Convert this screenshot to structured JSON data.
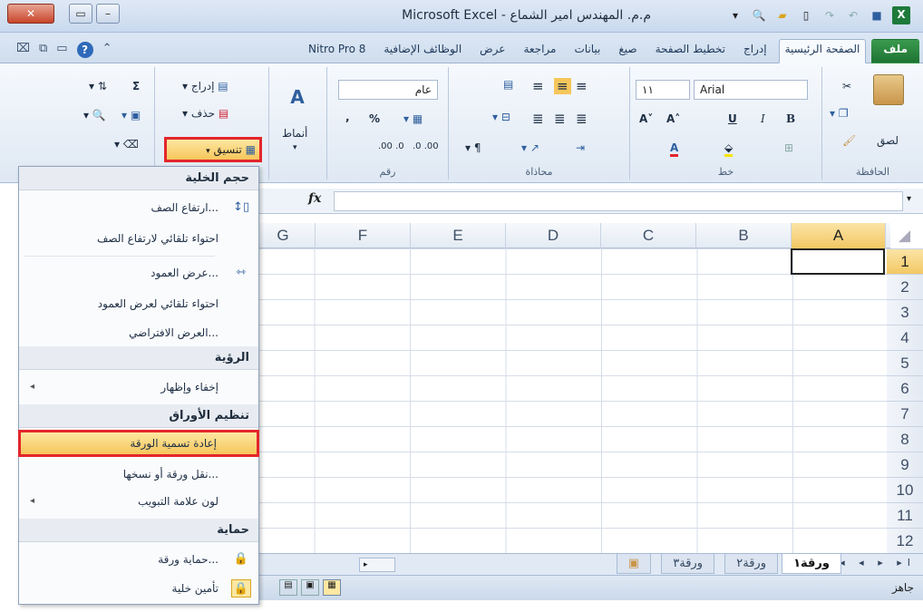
{
  "window": {
    "title": "م.م. المهندس امير الشماع - Microsoft Excel"
  },
  "tabs": {
    "file": "ملف",
    "home": "الصفحة الرئيسية",
    "insert": "إدراج",
    "page_layout": "تخطيط الصفحة",
    "formulas": "صيغ",
    "data": "بيانات",
    "review": "مراجعة",
    "view": "عرض",
    "addins": "الوظائف الإضافية",
    "nitro": "Nitro Pro 8"
  },
  "ribbon": {
    "clipboard": {
      "label": "الحافظة",
      "paste": "لصق"
    },
    "font": {
      "label": "خط",
      "name": "Arial",
      "size": "١١",
      "bold": "B",
      "italic": "I",
      "underline": "U"
    },
    "alignment": {
      "label": "محاذاة"
    },
    "number": {
      "label": "رقم",
      "format": "عام",
      "percent": "%",
      "comma": ","
    },
    "styles": {
      "label": "أنماط"
    },
    "cells": {
      "insert": "إدراج",
      "delete": "حذف",
      "format": "تنسيق"
    },
    "editing": {
      "sum": "Σ"
    }
  },
  "formula_bar": {
    "fx": "fx"
  },
  "grid": {
    "columns": [
      "A",
      "B",
      "C",
      "D",
      "E",
      "F",
      "G"
    ],
    "rows": [
      "1",
      "2",
      "3",
      "4",
      "5",
      "6",
      "7",
      "8",
      "9",
      "10",
      "11",
      "12"
    ],
    "selected_cell": "A1"
  },
  "menu": {
    "sections": {
      "cell_size": "حجم الخلية",
      "visibility": "الرؤية",
      "organize_sheets": "تنظيم الأوراق",
      "protection": "حماية"
    },
    "items": {
      "row_height": "ارتفاع الصف...",
      "autofit_row": "احتواء تلقائي لارتفاع الصف",
      "column_width": "عرض العمود...",
      "autofit_column": "احتواء تلقائي لعرض العمود",
      "default_width": "العرض الافتراضي...",
      "hide_unhide": "إخفاء وإظهار",
      "rename_sheet": "إعادة تسمية الورقة",
      "move_copy": "نقل ورقة أو نسخها...",
      "tab_color": "لون علامة التبويب",
      "protect_sheet": "حماية ورقة...",
      "lock_cell": "تأمين خلية"
    }
  },
  "sheets": {
    "sheet1": "ورقة١",
    "sheet2": "ورقة٢",
    "sheet3": "ورقة٣"
  },
  "status": {
    "ready": "جاهز"
  }
}
